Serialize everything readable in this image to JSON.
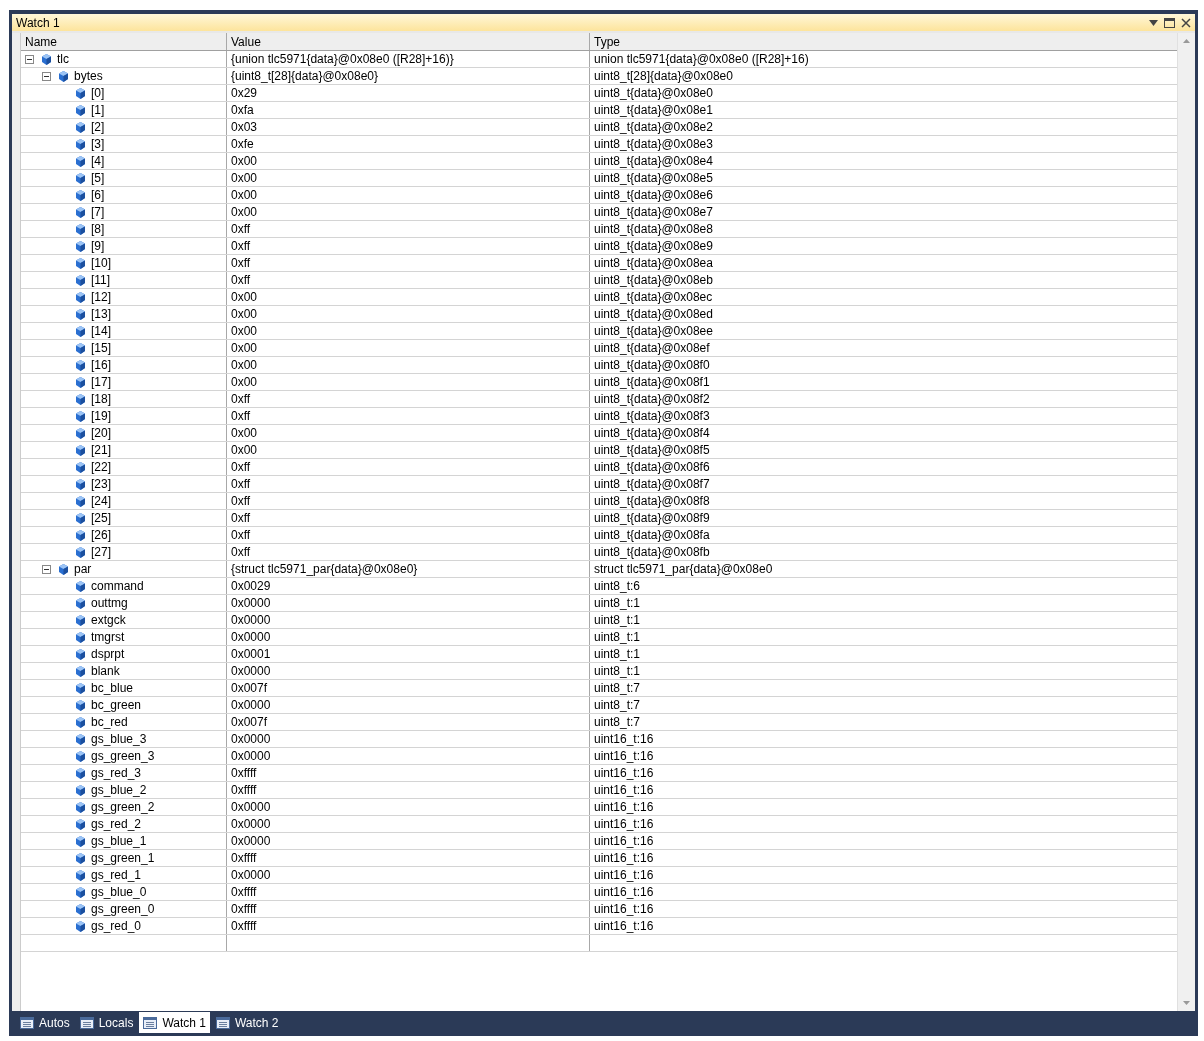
{
  "window": {
    "title": "Watch 1"
  },
  "columns": [
    "Name",
    "Value",
    "Type"
  ],
  "items": [
    {
      "name": "tlc",
      "value": "{union tlc5971{data}@0x08e0 ([R28]+16)}",
      "type": "union tlc5971{data}@0x08e0 ([R28]+16)",
      "expanded": true,
      "children": [
        {
          "name": "bytes",
          "value": "{uint8_t[28]{data}@0x08e0}",
          "type": "uint8_t[28]{data}@0x08e0",
          "expanded": true,
          "children": [
            {
              "name": "[0]",
              "value": "0x29",
              "type": "uint8_t{data}@0x08e0"
            },
            {
              "name": "[1]",
              "value": "0xfa",
              "type": "uint8_t{data}@0x08e1"
            },
            {
              "name": "[2]",
              "value": "0x03",
              "type": "uint8_t{data}@0x08e2"
            },
            {
              "name": "[3]",
              "value": "0xfe",
              "type": "uint8_t{data}@0x08e3"
            },
            {
              "name": "[4]",
              "value": "0x00",
              "type": "uint8_t{data}@0x08e4"
            },
            {
              "name": "[5]",
              "value": "0x00",
              "type": "uint8_t{data}@0x08e5"
            },
            {
              "name": "[6]",
              "value": "0x00",
              "type": "uint8_t{data}@0x08e6"
            },
            {
              "name": "[7]",
              "value": "0x00",
              "type": "uint8_t{data}@0x08e7"
            },
            {
              "name": "[8]",
              "value": "0xff",
              "type": "uint8_t{data}@0x08e8"
            },
            {
              "name": "[9]",
              "value": "0xff",
              "type": "uint8_t{data}@0x08e9"
            },
            {
              "name": "[10]",
              "value": "0xff",
              "type": "uint8_t{data}@0x08ea"
            },
            {
              "name": "[11]",
              "value": "0xff",
              "type": "uint8_t{data}@0x08eb"
            },
            {
              "name": "[12]",
              "value": "0x00",
              "type": "uint8_t{data}@0x08ec"
            },
            {
              "name": "[13]",
              "value": "0x00",
              "type": "uint8_t{data}@0x08ed"
            },
            {
              "name": "[14]",
              "value": "0x00",
              "type": "uint8_t{data}@0x08ee"
            },
            {
              "name": "[15]",
              "value": "0x00",
              "type": "uint8_t{data}@0x08ef"
            },
            {
              "name": "[16]",
              "value": "0x00",
              "type": "uint8_t{data}@0x08f0"
            },
            {
              "name": "[17]",
              "value": "0x00",
              "type": "uint8_t{data}@0x08f1"
            },
            {
              "name": "[18]",
              "value": "0xff",
              "type": "uint8_t{data}@0x08f2"
            },
            {
              "name": "[19]",
              "value": "0xff",
              "type": "uint8_t{data}@0x08f3"
            },
            {
              "name": "[20]",
              "value": "0x00",
              "type": "uint8_t{data}@0x08f4"
            },
            {
              "name": "[21]",
              "value": "0x00",
              "type": "uint8_t{data}@0x08f5"
            },
            {
              "name": "[22]",
              "value": "0xff",
              "type": "uint8_t{data}@0x08f6"
            },
            {
              "name": "[23]",
              "value": "0xff",
              "type": "uint8_t{data}@0x08f7"
            },
            {
              "name": "[24]",
              "value": "0xff",
              "type": "uint8_t{data}@0x08f8"
            },
            {
              "name": "[25]",
              "value": "0xff",
              "type": "uint8_t{data}@0x08f9"
            },
            {
              "name": "[26]",
              "value": "0xff",
              "type": "uint8_t{data}@0x08fa"
            },
            {
              "name": "[27]",
              "value": "0xff",
              "type": "uint8_t{data}@0x08fb"
            }
          ]
        },
        {
          "name": "par",
          "value": "{struct tlc5971_par{data}@0x08e0}",
          "type": "struct tlc5971_par{data}@0x08e0",
          "expanded": true,
          "children": [
            {
              "name": "command",
              "value": "0x0029",
              "type": "uint8_t:6"
            },
            {
              "name": "outtmg",
              "value": "0x0000",
              "type": "uint8_t:1"
            },
            {
              "name": "extgck",
              "value": "0x0000",
              "type": "uint8_t:1"
            },
            {
              "name": "tmgrst",
              "value": "0x0000",
              "type": "uint8_t:1"
            },
            {
              "name": "dsprpt",
              "value": "0x0001",
              "type": "uint8_t:1"
            },
            {
              "name": "blank",
              "value": "0x0000",
              "type": "uint8_t:1"
            },
            {
              "name": "bc_blue",
              "value": "0x007f",
              "type": "uint8_t:7"
            },
            {
              "name": "bc_green",
              "value": "0x0000",
              "type": "uint8_t:7"
            },
            {
              "name": "bc_red",
              "value": "0x007f",
              "type": "uint8_t:7"
            },
            {
              "name": "gs_blue_3",
              "value": "0x0000",
              "type": "uint16_t:16"
            },
            {
              "name": "gs_green_3",
              "value": "0x0000",
              "type": "uint16_t:16"
            },
            {
              "name": "gs_red_3",
              "value": "0xffff",
              "type": "uint16_t:16"
            },
            {
              "name": "gs_blue_2",
              "value": "0xffff",
              "type": "uint16_t:16"
            },
            {
              "name": "gs_green_2",
              "value": "0x0000",
              "type": "uint16_t:16"
            },
            {
              "name": "gs_red_2",
              "value": "0x0000",
              "type": "uint16_t:16"
            },
            {
              "name": "gs_blue_1",
              "value": "0x0000",
              "type": "uint16_t:16"
            },
            {
              "name": "gs_green_1",
              "value": "0xffff",
              "type": "uint16_t:16"
            },
            {
              "name": "gs_red_1",
              "value": "0x0000",
              "type": "uint16_t:16"
            },
            {
              "name": "gs_blue_0",
              "value": "0xffff",
              "type": "uint16_t:16"
            },
            {
              "name": "gs_green_0",
              "value": "0xffff",
              "type": "uint16_t:16"
            },
            {
              "name": "gs_red_0",
              "value": "0xffff",
              "type": "uint16_t:16"
            }
          ]
        }
      ]
    }
  ],
  "tabs": [
    {
      "label": "Autos",
      "selected": false
    },
    {
      "label": "Locals",
      "selected": false
    },
    {
      "label": "Watch 1",
      "selected": true
    },
    {
      "label": "Watch 2",
      "selected": false
    }
  ]
}
